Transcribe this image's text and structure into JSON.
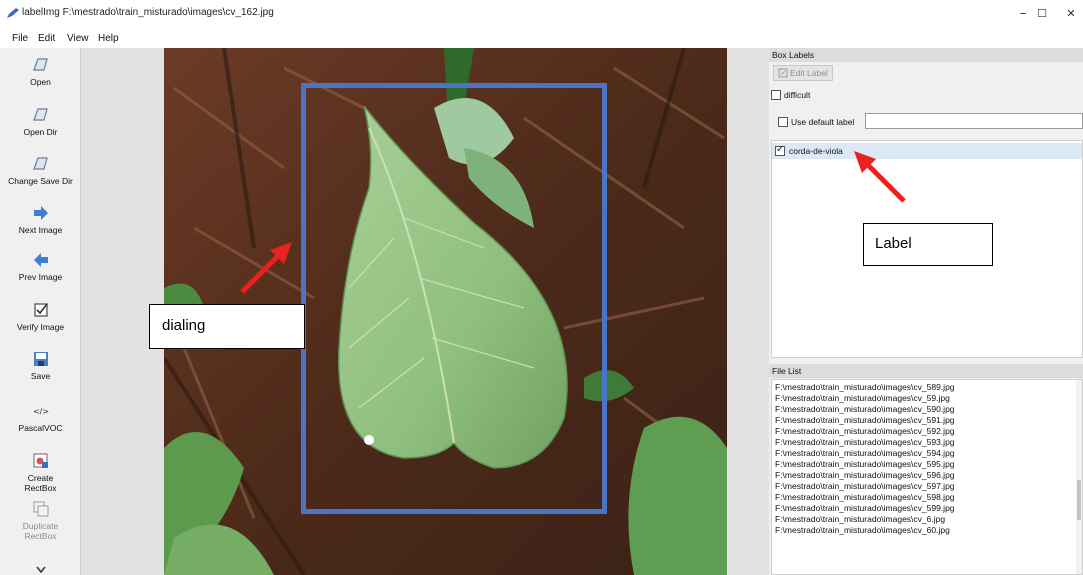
{
  "window": {
    "title": "labelImg F:\\mestrado\\train_misturado\\images\\cv_162.jpg",
    "minimize": "–",
    "maximize": "☐",
    "close": "✕"
  },
  "menu": [
    "File",
    "Edit",
    "View",
    "Help"
  ],
  "toolbar": [
    {
      "label": "Open",
      "icon": "folder-open-icon"
    },
    {
      "label": "Open Dir",
      "icon": "folder-open-icon"
    },
    {
      "label": "Change Save Dir",
      "icon": "folder-open-icon"
    },
    {
      "label": "Next Image",
      "icon": "arrow-right-icon"
    },
    {
      "label": "Prev Image",
      "icon": "arrow-left-icon"
    },
    {
      "label": "Verify Image",
      "icon": "checkbox-icon"
    },
    {
      "label": "Save",
      "icon": "floppy-disk-icon"
    },
    {
      "label": "PascalVOC",
      "icon": "code-tag-icon"
    },
    {
      "label": "Create\nRectBox",
      "icon": "create-rectbox-icon"
    },
    {
      "label": "Duplicate\nRectBox",
      "icon": "duplicate-rectbox-icon"
    }
  ],
  "annotations": {
    "dialing": "dialing",
    "label": "Label",
    "arrow_color": "#e8231f"
  },
  "box_labels": {
    "title": "Box Labels",
    "edit_label": "Edit Label",
    "difficult": "difficult",
    "use_default_label": "Use default label",
    "default_label_value": "",
    "items": [
      {
        "text": "corda-de-viola",
        "checked": true
      }
    ]
  },
  "file_list": {
    "title": "File List",
    "items": [
      "F:\\mestrado\\train_misturado\\images\\cv_589.jpg",
      "F:\\mestrado\\train_misturado\\images\\cv_59.jpg",
      "F:\\mestrado\\train_misturado\\images\\cv_590.jpg",
      "F:\\mestrado\\train_misturado\\images\\cv_591.jpg",
      "F:\\mestrado\\train_misturado\\images\\cv_592.jpg",
      "F:\\mestrado\\train_misturado\\images\\cv_593.jpg",
      "F:\\mestrado\\train_misturado\\images\\cv_594.jpg",
      "F:\\mestrado\\train_misturado\\images\\cv_595.jpg",
      "F:\\mestrado\\train_misturado\\images\\cv_596.jpg",
      "F:\\mestrado\\train_misturado\\images\\cv_597.jpg",
      "F:\\mestrado\\train_misturado\\images\\cv_598.jpg",
      "F:\\mestrado\\train_misturado\\images\\cv_599.jpg",
      "F:\\mestrado\\train_misturado\\images\\cv_6.jpg",
      "F:\\mestrado\\train_misturado\\images\\cv_60.jpg"
    ]
  },
  "colors": {
    "bbox": "#4a74c4",
    "soil": "#5a3220",
    "leaf": "#8fbf7e"
  }
}
